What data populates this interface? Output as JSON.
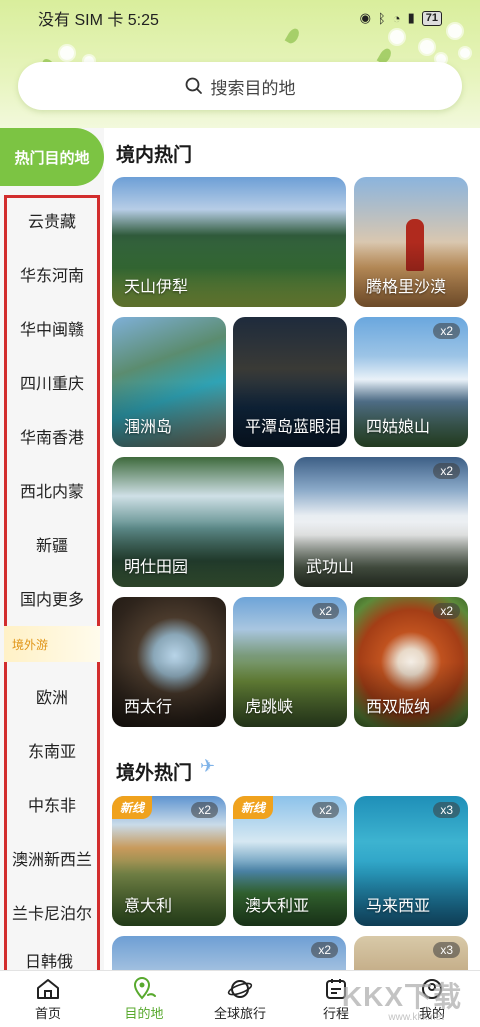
{
  "status_bar": {
    "carrier_time": "没有 SIM 卡 5:25",
    "battery": "71"
  },
  "search": {
    "placeholder": "搜索目的地"
  },
  "sidebar": {
    "active": "热门目的地",
    "items": [
      "云贵藏",
      "华东河南",
      "华中闽赣",
      "四川重庆",
      "华南香港",
      "西北内蒙",
      "新疆",
      "国内更多",
      "境外游",
      "欧洲",
      "东南亚",
      "中东非",
      "澳洲新西兰",
      "兰卡尼泊尔",
      "日韩俄"
    ]
  },
  "domestic": {
    "title": "境内热门",
    "cards": [
      {
        "name": "天山伊犁",
        "badge": ""
      },
      {
        "name": "腾格里沙漠",
        "badge": ""
      },
      {
        "name": "涠洲岛",
        "badge": ""
      },
      {
        "name": "平潭岛蓝眼泪",
        "badge": ""
      },
      {
        "name": "四姑娘山",
        "badge": "x2"
      },
      {
        "name": "明仕田园",
        "badge": ""
      },
      {
        "name": "武功山",
        "badge": "x2"
      },
      {
        "name": "西太行",
        "badge": ""
      },
      {
        "name": "虎跳峡",
        "badge": "x2"
      },
      {
        "name": "西双版纳",
        "badge": "x2"
      }
    ]
  },
  "overseas": {
    "title": "境外热门",
    "cards": [
      {
        "name": "意大利",
        "badge": "x2",
        "tag": "新线"
      },
      {
        "name": "澳大利亚",
        "badge": "x2",
        "tag": "新线"
      },
      {
        "name": "马来西亚",
        "badge": "x3",
        "tag": ""
      }
    ],
    "partial_badges": [
      "x2",
      "x3"
    ]
  },
  "nav": {
    "items": [
      "首页",
      "目的地",
      "全球旅行",
      "行程",
      "我的"
    ],
    "active_index": 1
  },
  "watermark": {
    "text": "KKX下载",
    "sub": "www.kkx.net"
  },
  "colors": {
    "accent": "#7cc443",
    "outline": "#d22d2d",
    "tag_orange": "#f0a21d"
  }
}
